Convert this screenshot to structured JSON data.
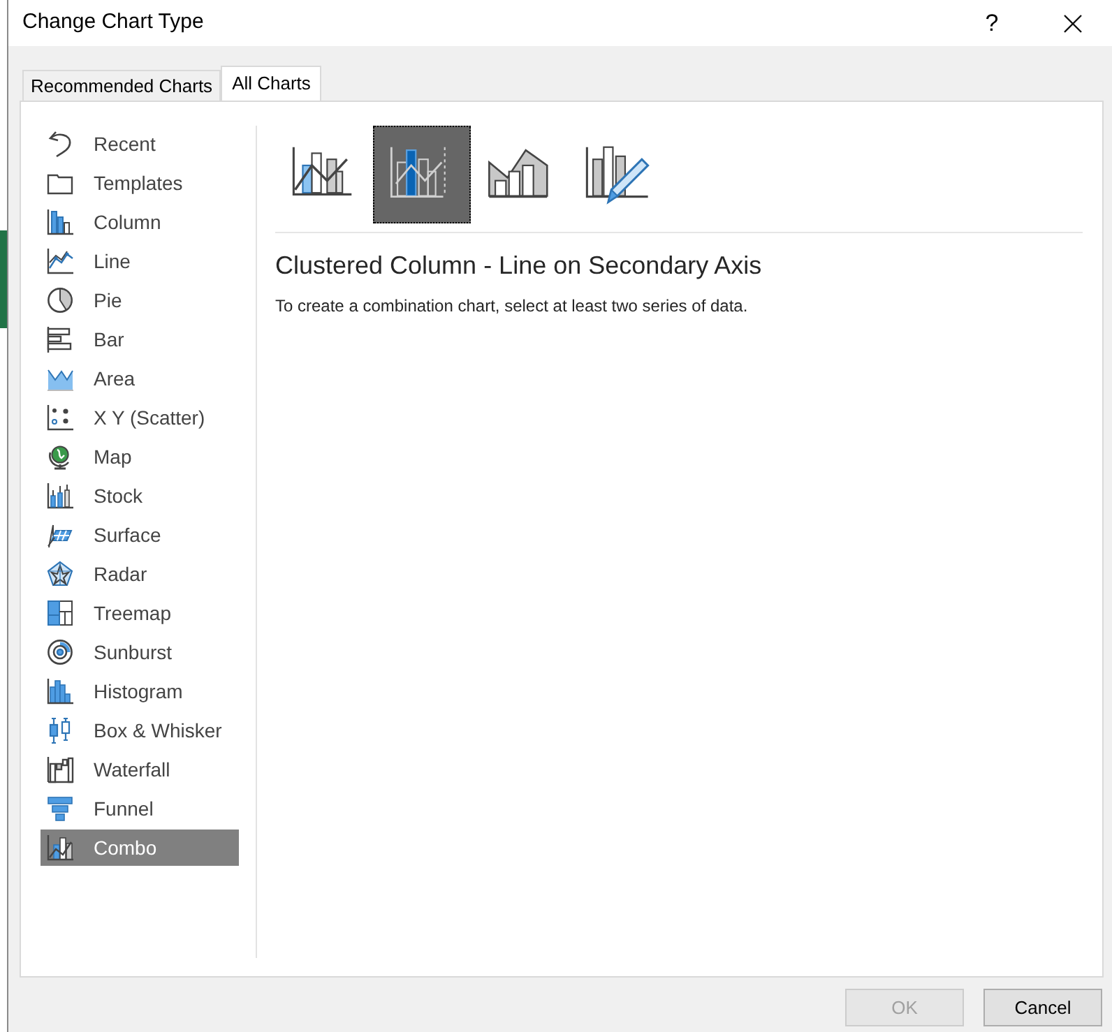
{
  "window": {
    "title": "Change Chart Type",
    "help": "?"
  },
  "tabs": [
    {
      "label": "Recommended Charts",
      "selected": false
    },
    {
      "label": "All Charts",
      "selected": true
    }
  ],
  "chart_types": [
    {
      "kind": "recent",
      "label": "Recent",
      "selected": false
    },
    {
      "kind": "templates",
      "label": "Templates",
      "selected": false
    },
    {
      "kind": "column",
      "label": "Column",
      "selected": false
    },
    {
      "kind": "line",
      "label": "Line",
      "selected": false
    },
    {
      "kind": "pie",
      "label": "Pie",
      "selected": false
    },
    {
      "kind": "bar",
      "label": "Bar",
      "selected": false
    },
    {
      "kind": "area",
      "label": "Area",
      "selected": false
    },
    {
      "kind": "scatter",
      "label": "X Y (Scatter)",
      "selected": false
    },
    {
      "kind": "map",
      "label": "Map",
      "selected": false
    },
    {
      "kind": "stock",
      "label": "Stock",
      "selected": false
    },
    {
      "kind": "surface",
      "label": "Surface",
      "selected": false
    },
    {
      "kind": "radar",
      "label": "Radar",
      "selected": false
    },
    {
      "kind": "treemap",
      "label": "Treemap",
      "selected": false
    },
    {
      "kind": "sunburst",
      "label": "Sunburst",
      "selected": false
    },
    {
      "kind": "histogram",
      "label": "Histogram",
      "selected": false
    },
    {
      "kind": "boxwhisker",
      "label": "Box & Whisker",
      "selected": false
    },
    {
      "kind": "waterfall",
      "label": "Waterfall",
      "selected": false
    },
    {
      "kind": "funnel",
      "label": "Funnel",
      "selected": false
    },
    {
      "kind": "combo",
      "label": "Combo",
      "selected": true
    }
  ],
  "subtypes": [
    {
      "kind": "combo",
      "selected": false
    },
    {
      "kind": "secondary",
      "selected": true
    },
    {
      "kind": "area",
      "selected": false
    },
    {
      "kind": "custom",
      "selected": false
    }
  ],
  "detail": {
    "title": "Clustered Column - Line on Secondary Axis",
    "description": "To create a combination chart, select at least two series of data."
  },
  "buttons": [
    {
      "label": "OK",
      "disabled": true
    },
    {
      "label": "Cancel",
      "disabled": false
    }
  ]
}
